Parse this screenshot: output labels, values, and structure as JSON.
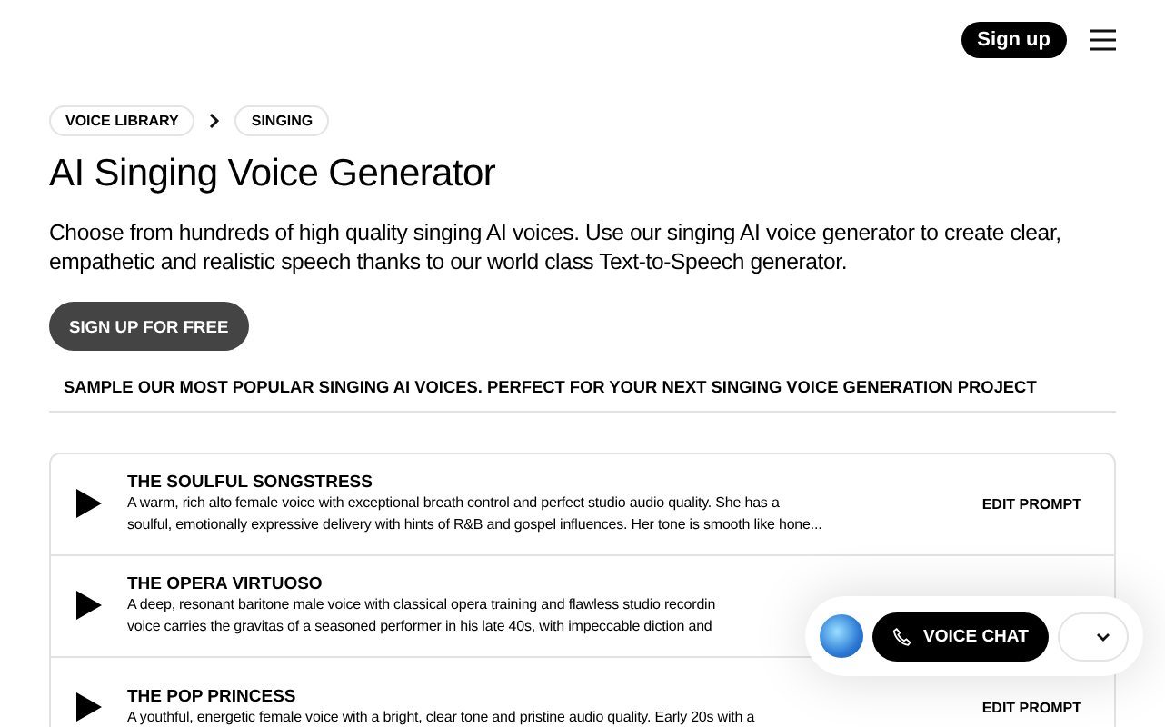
{
  "header": {
    "signup_button": "Sign up"
  },
  "breadcrumbs": [
    {
      "label": "VOICE LIBRARY"
    },
    {
      "label": "SINGING"
    }
  ],
  "title": "AI Singing Voice Generator",
  "intro": "Choose from hundreds of high quality singing AI voices. Use our singing AI voice generator to create clear, empathetic and realistic speech thanks to our world class Text-to-Speech generator.",
  "cta_button": "SIGN UP FOR FREE",
  "section_heading": "SAMPLE OUR MOST POPULAR SINGING AI VOICES. PERFECT FOR YOUR NEXT SINGING VOICE GENERATION PROJECT",
  "voices": [
    {
      "name": "THE SOULFUL SONGSTRESS",
      "description_lines": [
        "A warm, rich alto female voice with exceptional breath control and perfect studio audio quality. She has a",
        "soulful, emotionally expressive delivery with hints of R&B and gospel influences. Her tone is smooth like hone..."
      ],
      "action": "EDIT PROMPT"
    },
    {
      "name": "THE OPERA VIRTUOSO",
      "description_lines": [
        "A deep, resonant baritone male voice with classical opera training and flawless studio recordin",
        "voice carries the gravitas of a seasoned performer in his late 40s, with impeccable diction and"
      ]
    },
    {
      "name": "THE POP PRINCESS",
      "description_lines": [
        "A youthful, energetic female voice with a bright, clear tone and pristine audio quality. Early 20s with a"
      ],
      "action": "EDIT PROMPT"
    }
  ],
  "voice_widget": {
    "button": "VOICE CHAT"
  }
}
